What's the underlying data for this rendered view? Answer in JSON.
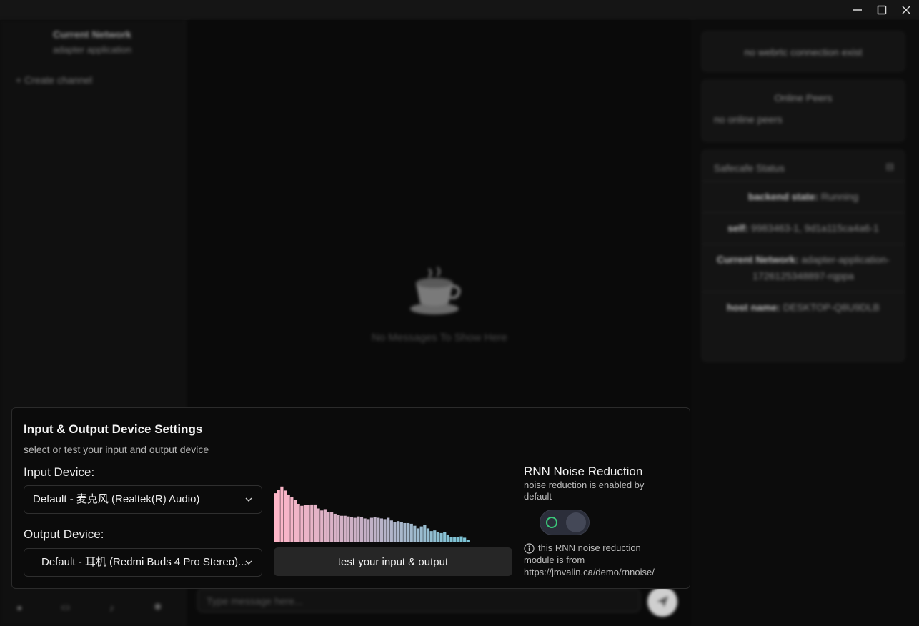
{
  "window": {
    "controls": [
      {
        "name": "minimize",
        "icon": "minimize-icon"
      },
      {
        "name": "maximize",
        "icon": "maximize-icon"
      },
      {
        "name": "close",
        "icon": "close-icon"
      }
    ]
  },
  "sidebar": {
    "network_title": "Current Network",
    "network_subtitle": "adapter application",
    "create_channel": "+ Create channel"
  },
  "main": {
    "empty_text": "No Messages To Show Here",
    "message_placeholder": "Type message here..."
  },
  "right_panel": {
    "ws_status": "no webrtc connection exist",
    "peers_title": "Online Peers",
    "peers_text": "no online peers",
    "status_title": "Safecafe Status",
    "backend_label": "backend state:",
    "backend_value": "Running",
    "self_label": "self:",
    "self_value": "9983463-1, 9d1a115ca4a6-1",
    "network_label": "Current Network:",
    "network_value": "adapter-application-1726125348897-rqppa",
    "host_label": "host name:",
    "host_value": "DESKTOP-Q8U9DLB"
  },
  "settings": {
    "title": "Input & Output Device Settings",
    "subtitle": "select or test your input and output device",
    "input_label": "Input Device:",
    "input_value": "Default - 麦克风 (Realtek(R) Audio)",
    "output_label": "Output Device:",
    "output_value": "Default - 耳机 (Redmi Buds 4 Pro Stereo)...",
    "test_button": "test your input & output",
    "rnn_title": "RNN Noise Reduction",
    "rnn_desc": "noise reduction is enabled by default",
    "rnn_enabled": true,
    "rnn_note": "this RNN noise reduction module is from",
    "rnn_link": "https://jmvalin.ca/demo/rnnoise/",
    "visualizer_levels": [
      0.73,
      0.78,
      0.83,
      0.77,
      0.71,
      0.67,
      0.63,
      0.57,
      0.54,
      0.55,
      0.55,
      0.56,
      0.56,
      0.5,
      0.47,
      0.49,
      0.45,
      0.45,
      0.42,
      0.4,
      0.39,
      0.39,
      0.38,
      0.37,
      0.36,
      0.38,
      0.37,
      0.35,
      0.34,
      0.36,
      0.37,
      0.36,
      0.35,
      0.34,
      0.36,
      0.32,
      0.3,
      0.31,
      0.3,
      0.28,
      0.28,
      0.27,
      0.24,
      0.2,
      0.23,
      0.25,
      0.2,
      0.16,
      0.17,
      0.15,
      0.13,
      0.15,
      0.1,
      0.07,
      0.07,
      0.07,
      0.08,
      0.06,
      0.03
    ],
    "colors": {
      "start": "#ffb6c8",
      "mid": "#c4b0c6",
      "end": "#7ec4d6"
    }
  }
}
